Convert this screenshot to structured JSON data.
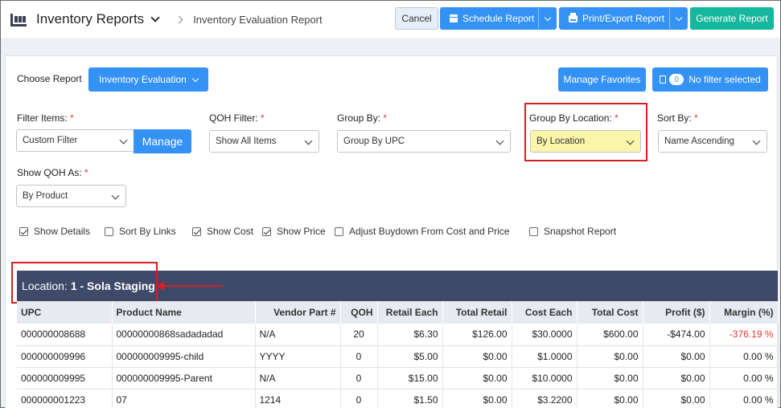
{
  "header": {
    "title": "Inventory Reports",
    "breadcrumb": "Inventory Evaluation Report",
    "cancel_label": "Cancel",
    "schedule_label": "Schedule Report",
    "print_label": "Print/Export Report",
    "generate_label": "Generate Report"
  },
  "toolbar": {
    "choose_label": "Choose Report",
    "report_selected": "Inventory Evaluation",
    "favorites_label": "Manage Favorites",
    "filter_count": "0",
    "filter_label": "No filter selected"
  },
  "filters": {
    "filter_items_label": "Filter Items:",
    "filter_items_value": "Custom Filter",
    "manage_label": "Manage",
    "qoh_filter_label": "QOH Filter:",
    "qoh_filter_value": "Show All Items",
    "group_by_label": "Group By:",
    "group_by_value": "Group By UPC",
    "group_loc_label": "Group By Location:",
    "group_loc_value": "By Location",
    "sort_by_label": "Sort By:",
    "sort_by_value": "Name Ascending",
    "show_qoh_label": "Show QOH As:",
    "show_qoh_value": "By Product",
    "required_mark": "*"
  },
  "options": [
    {
      "label": "Show Details",
      "checked": true
    },
    {
      "label": "Sort By Links",
      "checked": false
    },
    {
      "label": "Show Cost",
      "checked": true
    },
    {
      "label": "Show Price",
      "checked": true
    },
    {
      "label": "Adjust Buydown From Cost and Price",
      "checked": false
    },
    {
      "label": "Snapshot Report",
      "checked": false
    }
  ],
  "location": {
    "prefix": "Location:",
    "name": "1 - Sola Staging"
  },
  "table": {
    "columns": [
      "UPC",
      "Product Name",
      "Vendor Part #",
      "QOH",
      "Retail Each",
      "Total Retail",
      "Cost Each",
      "Total Cost",
      "Profit ($)",
      "Margin (%)"
    ],
    "rows": [
      [
        "000000008688",
        "00000000868sadadadad",
        "N/A",
        "20",
        "$6.30",
        "$126.00",
        "$30.0000",
        "$600.00",
        "-$474.00",
        "-376.19 %"
      ],
      [
        "000000009996",
        "000000009995-child",
        "YYYY",
        "0",
        "$5.00",
        "$0.00",
        "$1.0000",
        "$0.00",
        "$0.00",
        "0.00 %"
      ],
      [
        "000000009995",
        "000000009995-Parent",
        "N/A",
        "0",
        "$15.00",
        "$0.00",
        "$10.0000",
        "$0.00",
        "$0.00",
        "0.00 %"
      ],
      [
        "000000001223",
        "07",
        "1214",
        "0",
        "$1.50",
        "$0.00",
        "$3.2200",
        "$0.00",
        "$0.00",
        "0.00 %"
      ]
    ]
  },
  "colors": {
    "accent": "#3592f5",
    "green": "#14b89d",
    "highlight": "#d42020",
    "location_bar": "#3e4a68"
  }
}
